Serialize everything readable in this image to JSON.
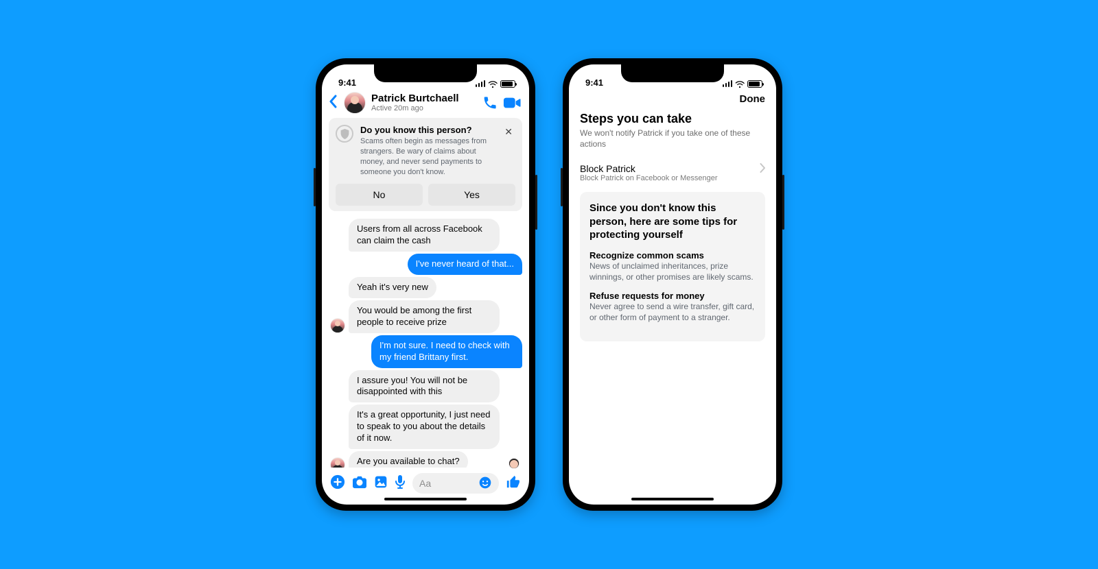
{
  "colors": {
    "accent": "#0a84ff",
    "bg": "#0e9dff"
  },
  "status_time": "9:41",
  "phone1": {
    "header": {
      "name": "Patrick Burtchaell",
      "status": "Active 20m ago"
    },
    "banner": {
      "title": "Do you know this person?",
      "body": "Scams often begin as messages from strangers. Be wary of claims about money, and never send payments to someone you don't know.",
      "no": "No",
      "yes": "Yes"
    },
    "messages": [
      {
        "dir": "in",
        "text": "Users from all across Facebook can claim the cash"
      },
      {
        "dir": "out",
        "text": "I've never heard of that..."
      },
      {
        "dir": "in",
        "text": "Yeah it's very new"
      },
      {
        "dir": "in",
        "text": "You would be among the first people to receive prize"
      },
      {
        "dir": "out",
        "text": "I'm not sure. I need to check with my friend Brittany first."
      },
      {
        "dir": "in",
        "text": "I assure you! You will not be disappointed with this"
      },
      {
        "dir": "in",
        "text": "It's a great opportunity, I just need to speak to you about the details of it now."
      },
      {
        "dir": "in",
        "text": "Are you available to chat?"
      }
    ],
    "composer": {
      "placeholder": "Aa"
    }
  },
  "phone2": {
    "done": "Done",
    "title": "Steps you can take",
    "subtitle": "We won't notify Patrick if you take one of these actions",
    "block": {
      "title": "Block Patrick",
      "subtitle": "Block Patrick on Facebook or Messenger"
    },
    "tips": {
      "heading": "Since you don't know this person, here are some tips for protecting yourself",
      "items": [
        {
          "title": "Recognize common scams",
          "body": "News of unclaimed inheritances, prize winnings, or other promises are likely scams."
        },
        {
          "title": "Refuse requests for money",
          "body": "Never agree to send a wire transfer, gift card, or other form of payment to a stranger."
        }
      ]
    }
  }
}
